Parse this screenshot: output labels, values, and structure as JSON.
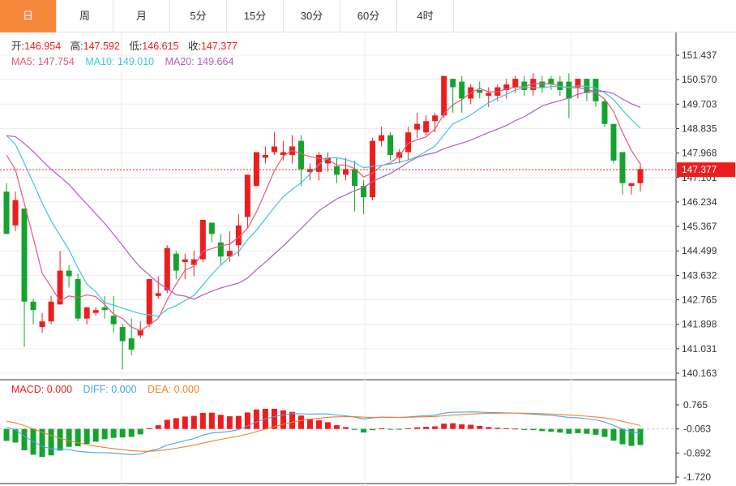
{
  "tabs": [
    {
      "label": "日",
      "active": true
    },
    {
      "label": "周",
      "active": false
    },
    {
      "label": "月",
      "active": false
    },
    {
      "label": "5分",
      "active": false
    },
    {
      "label": "15分",
      "active": false
    },
    {
      "label": "30分",
      "active": false
    },
    {
      "label": "60分",
      "active": false
    },
    {
      "label": "4时",
      "active": false
    }
  ],
  "ohlc_legend": {
    "open_label": "开:",
    "open_value": "146.954",
    "high_label": "高:",
    "high_value": "147.592",
    "low_label": "低:",
    "low_value": "146.615",
    "close_label": "收:",
    "close_value": "147.377"
  },
  "ma_legend": {
    "ma5_label": "MA5: ",
    "ma5_value": "147.754",
    "ma10_label": "MA10: ",
    "ma10_value": "149.010",
    "ma20_label": "MA20: ",
    "ma20_value": "149.664"
  },
  "macd_legend": {
    "macd_label": "MACD: ",
    "macd_value": "0.000",
    "diff_label": "DIFF: ",
    "diff_value": "0.000",
    "dea_label": "DEA: ",
    "dea_value": "0.000"
  },
  "colors": {
    "up": "#ee1d1d",
    "down": "#14a42e",
    "ma5": "#e8577e",
    "ma10": "#3ec6dc",
    "ma20": "#b25cc0",
    "diff": "#4aa3e8",
    "dea": "#f0822f",
    "price_tag": "#ee1d1d"
  },
  "chart_data": [
    {
      "type": "candlestick",
      "yaxis_ticks": [
        "151.437",
        "150.570",
        "149.703",
        "148.835",
        "147.968",
        "147.101",
        "146.234",
        "145.367",
        "144.499",
        "143.632",
        "142.765",
        "141.898",
        "141.031",
        "140.163"
      ],
      "ylim": [
        140.163,
        151.437
      ],
      "current_price": "147.377",
      "candles": [
        [
          146.6,
          145.1,
          146.9,
          145.1
        ],
        [
          145.4,
          146.3,
          146.6,
          145.2
        ],
        [
          146.0,
          142.7,
          146.0,
          141.1
        ],
        [
          142.7,
          142.4,
          142.8,
          141.9
        ],
        [
          141.8,
          142.0,
          142.3,
          141.6
        ],
        [
          142.0,
          142.7,
          142.9,
          141.9
        ],
        [
          142.6,
          143.8,
          144.5,
          142.6
        ],
        [
          143.8,
          143.6,
          144.0,
          143.2
        ],
        [
          143.5,
          142.1,
          143.7,
          142.0
        ],
        [
          142.1,
          142.5,
          142.5,
          141.9
        ],
        [
          142.3,
          142.4,
          142.5,
          142.2
        ],
        [
          142.5,
          142.4,
          142.9,
          142.1
        ],
        [
          142.2,
          141.9,
          142.9,
          141.6
        ],
        [
          141.8,
          141.3,
          141.9,
          140.3
        ],
        [
          141.4,
          141.0,
          142.1,
          140.8
        ],
        [
          141.5,
          141.7,
          142.0,
          141.4
        ],
        [
          141.9,
          143.5,
          143.5,
          141.8
        ],
        [
          142.9,
          143.0,
          143.6,
          142.8
        ],
        [
          143.1,
          144.6,
          144.7,
          143.0
        ],
        [
          144.4,
          143.8,
          144.5,
          143.5
        ],
        [
          144.1,
          144.2,
          144.4,
          143.5
        ],
        [
          144.0,
          144.2,
          144.5,
          143.6
        ],
        [
          144.2,
          145.6,
          145.6,
          144.1
        ],
        [
          145.5,
          145.1,
          145.5,
          144.8
        ],
        [
          144.8,
          144.3,
          145.1,
          144.0
        ],
        [
          144.3,
          144.5,
          145.2,
          144.1
        ],
        [
          144.7,
          145.4,
          145.8,
          144.3
        ],
        [
          145.7,
          147.2,
          147.2,
          145.3
        ],
        [
          146.8,
          148.0,
          148.0,
          146.8
        ],
        [
          147.8,
          147.9,
          148.2,
          147.6
        ],
        [
          148.0,
          148.2,
          148.7,
          147.9
        ],
        [
          147.9,
          148.0,
          148.4,
          147.7
        ],
        [
          147.9,
          148.2,
          148.6,
          147.6
        ],
        [
          148.4,
          147.4,
          148.6,
          146.8
        ],
        [
          147.3,
          147.4,
          147.6,
          147.0
        ],
        [
          147.3,
          147.9,
          148.0,
          147.0
        ],
        [
          147.6,
          147.8,
          148.0,
          147.3
        ],
        [
          147.5,
          147.2,
          147.8,
          146.9
        ],
        [
          147.2,
          147.4,
          147.8,
          147.0
        ],
        [
          147.4,
          146.8,
          147.7,
          145.9
        ],
        [
          146.8,
          146.4,
          147.0,
          145.8
        ],
        [
          146.4,
          148.4,
          148.5,
          146.3
        ],
        [
          148.4,
          148.6,
          148.9,
          148.2
        ],
        [
          148.6,
          147.9,
          148.7,
          147.7
        ],
        [
          147.8,
          148.0,
          148.1,
          147.6
        ],
        [
          148.0,
          148.7,
          148.9,
          147.7
        ],
        [
          148.8,
          149.0,
          149.4,
          148.5
        ],
        [
          148.7,
          149.1,
          149.3,
          148.6
        ],
        [
          149.1,
          149.3,
          149.4,
          148.7
        ],
        [
          149.3,
          150.7,
          150.7,
          149.2
        ],
        [
          150.6,
          150.3,
          150.6,
          149.4
        ],
        [
          150.5,
          149.9,
          150.7,
          149.4
        ],
        [
          149.9,
          150.3,
          150.4,
          149.7
        ],
        [
          150.2,
          150.1,
          150.5,
          149.9
        ],
        [
          150.0,
          150.1,
          150.3,
          149.6
        ],
        [
          150.0,
          150.3,
          150.4,
          149.8
        ],
        [
          150.2,
          150.4,
          150.6,
          149.9
        ],
        [
          150.3,
          150.6,
          150.7,
          150.1
        ],
        [
          150.5,
          150.2,
          150.7,
          150.0
        ],
        [
          150.2,
          150.6,
          150.8,
          150.0
        ],
        [
          150.5,
          150.3,
          150.7,
          150.1
        ],
        [
          150.6,
          150.4,
          150.7,
          150.2
        ],
        [
          150.5,
          150.2,
          150.7,
          150.0
        ],
        [
          150.5,
          149.9,
          150.8,
          149.2
        ],
        [
          150.3,
          150.6,
          150.6,
          149.9
        ],
        [
          150.6,
          150.1,
          150.6,
          149.8
        ],
        [
          150.6,
          149.8,
          150.6,
          149.6
        ],
        [
          149.8,
          149.0,
          149.9,
          148.9
        ],
        [
          149.0,
          147.7,
          149.0,
          147.6
        ],
        [
          148.0,
          146.9,
          148.0,
          146.5
        ],
        [
          146.8,
          146.9,
          146.9,
          146.5
        ],
        [
          146.9,
          147.4,
          147.6,
          146.6
        ]
      ]
    },
    {
      "type": "macd",
      "yaxis_ticks": [
        "0.765",
        "-0.063",
        "-0.892",
        "-1.720"
      ],
      "ylim": [
        -1.72,
        0.765
      ]
    }
  ]
}
